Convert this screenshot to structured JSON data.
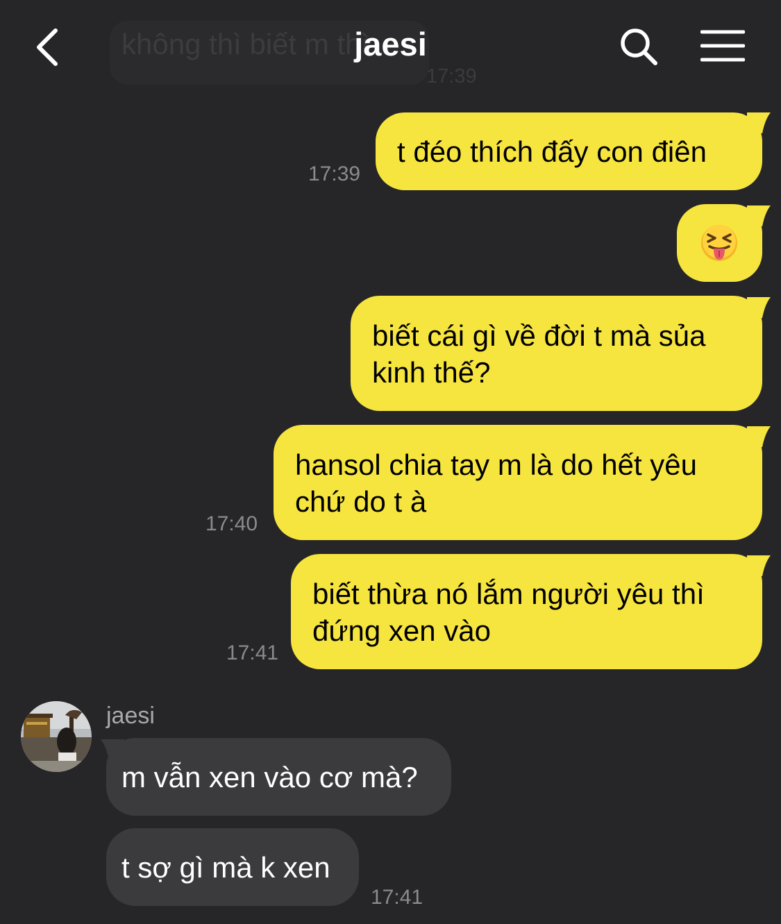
{
  "header": {
    "title": "jaesi",
    "ghost_message": "không thì biết m thì",
    "ghost_time": "17:39"
  },
  "messages": [
    {
      "from": "me",
      "lines": [
        "t đéo thích đấy con điên"
      ],
      "time": "17:39"
    },
    {
      "from": "me",
      "emoji": "squinting-face-with-tongue",
      "time": ""
    },
    {
      "from": "me",
      "lines": [
        "biết cái gì về đời t mà sủa",
        "kinh thế?"
      ],
      "time": ""
    },
    {
      "from": "me",
      "lines": [
        "hansol chia tay m là do hết yêu",
        "chứ do t à"
      ],
      "time": "17:40"
    },
    {
      "from": "me",
      "lines": [
        "biết thừa nó lắm người yêu thì",
        "đứng xen vào"
      ],
      "time": "17:41"
    },
    {
      "from": "jaesi",
      "lines": [
        "m vẫn xen vào cơ mà?"
      ],
      "time": ""
    },
    {
      "from": "jaesi",
      "lines": [
        "t sợ gì mà k xen"
      ],
      "time": "17:41"
    }
  ],
  "sender": {
    "name": "jaesi"
  },
  "colors": {
    "background": "#262628",
    "my_bubble": "#f7e53f",
    "their_bubble": "#3b3b3d",
    "time_text": "#8b8b8f"
  },
  "icons": {
    "back": "chevron-left-icon",
    "search": "search-icon",
    "menu": "hamburger-menu-icon"
  }
}
